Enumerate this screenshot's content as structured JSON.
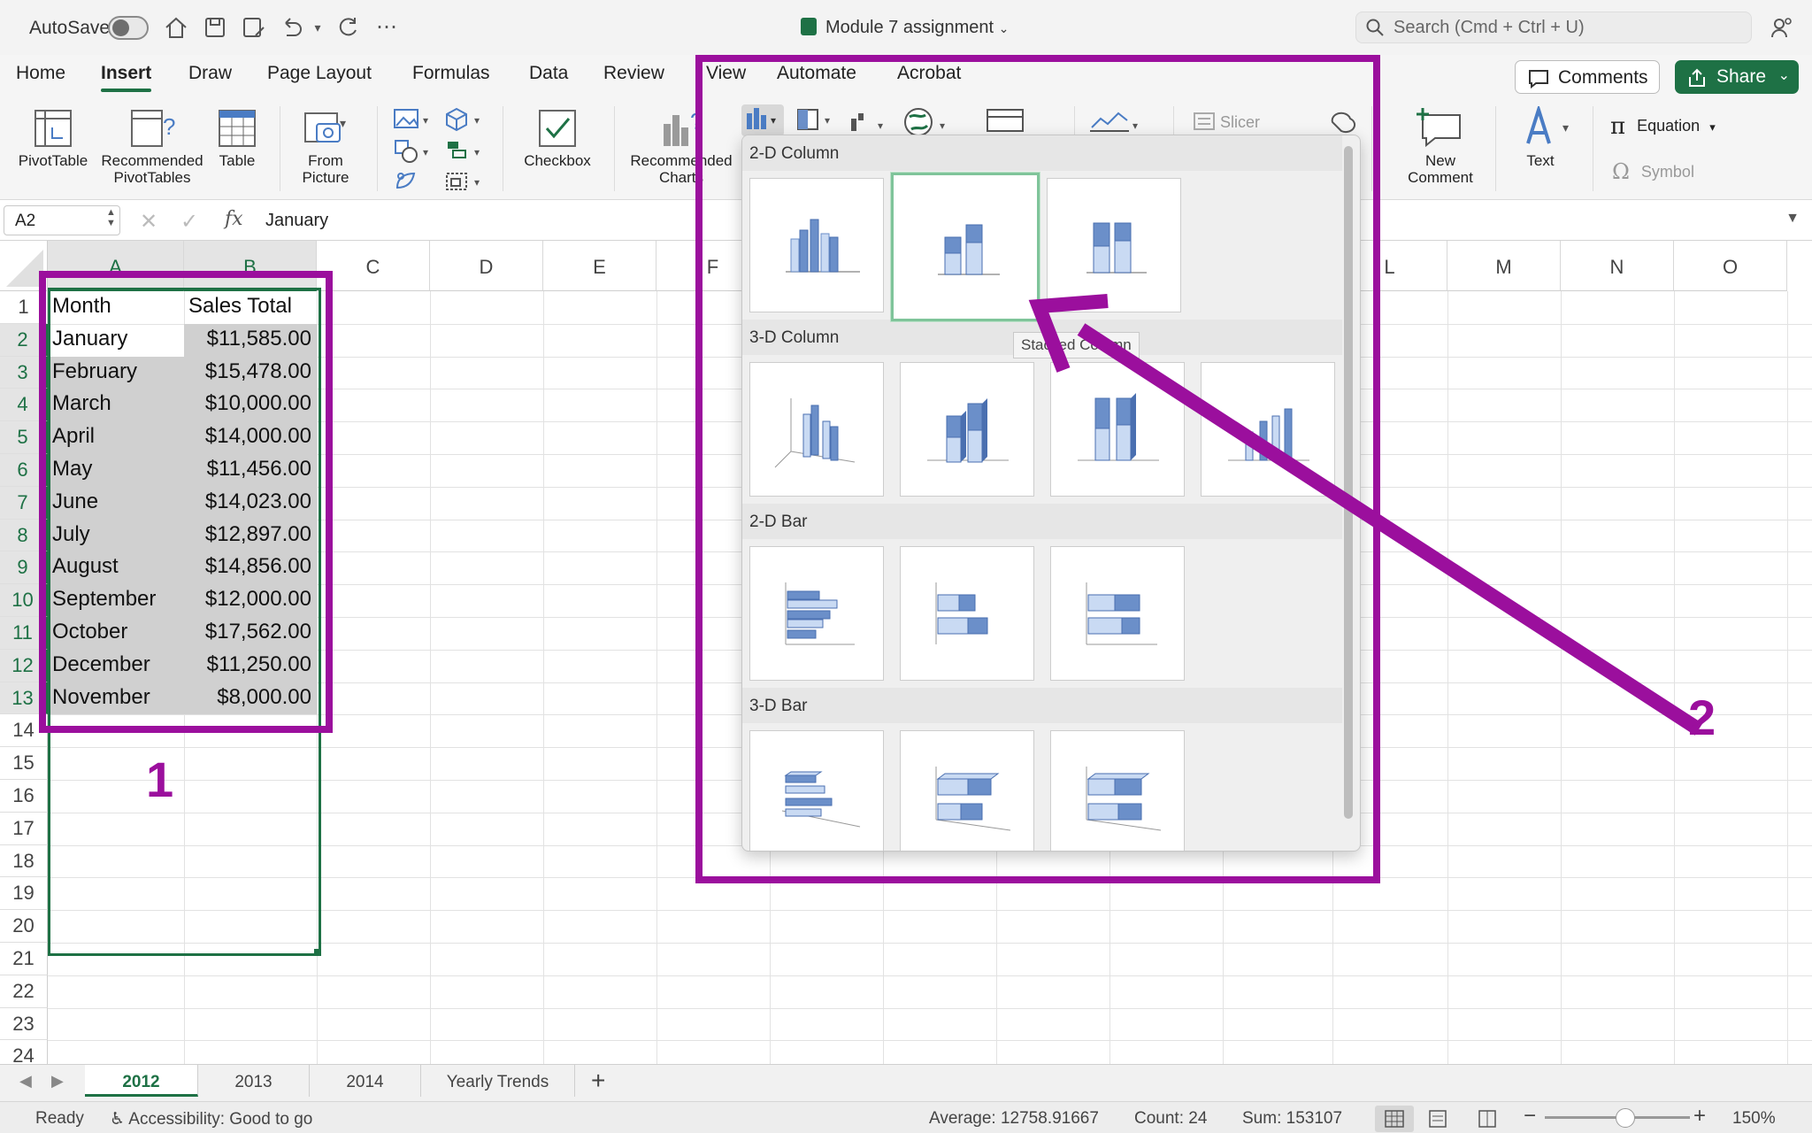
{
  "titlebar": {
    "autosave_label": "AutoSave",
    "document_title": "Module 7 assignment",
    "search_placeholder": "Search (Cmd + Ctrl + U)"
  },
  "ribbon_tabs": [
    "Home",
    "Insert",
    "Draw",
    "Page Layout",
    "Formulas",
    "Data",
    "Review",
    "View",
    "Automate",
    "Acrobat"
  ],
  "active_tab": "Insert",
  "header_buttons": {
    "comments": "Comments",
    "share": "Share"
  },
  "ribbon": {
    "pivot_table": "PivotTable",
    "recommended_pivot_1": "Recommended",
    "recommended_pivot_2": "PivotTables",
    "table": "Table",
    "from_picture_1": "From",
    "from_picture_2": "Picture",
    "checkbox": "Checkbox",
    "recommended_charts_1": "Recommended",
    "recommended_charts_2": "Charts",
    "slicer": "Slicer",
    "new_comment_1": "New",
    "new_comment_2": "Comment",
    "text": "Text",
    "equation": "Equation",
    "symbol": "Symbol"
  },
  "formula_bar": {
    "name_box": "A2",
    "fx": "fx",
    "value": "January"
  },
  "columns": [
    "A",
    "B",
    "C",
    "D",
    "E",
    "F",
    "L",
    "M",
    "N",
    "O"
  ],
  "rows": [
    "1",
    "2",
    "3",
    "4",
    "5",
    "6",
    "7",
    "8",
    "9",
    "10",
    "11",
    "12",
    "13",
    "14",
    "15",
    "16",
    "17",
    "18",
    "19",
    "20",
    "21",
    "22",
    "23",
    "24"
  ],
  "table": {
    "headers": [
      "Month",
      "Sales Total"
    ],
    "data": [
      [
        "January",
        "$11,585.00"
      ],
      [
        "February",
        "$15,478.00"
      ],
      [
        "March",
        "$10,000.00"
      ],
      [
        "April",
        "$14,000.00"
      ],
      [
        "May",
        "$11,456.00"
      ],
      [
        "June",
        "$14,023.00"
      ],
      [
        "July",
        "$12,897.00"
      ],
      [
        "August",
        "$14,856.00"
      ],
      [
        "September",
        "$12,000.00"
      ],
      [
        "October",
        "$17,562.00"
      ],
      [
        "December",
        "$11,250.00"
      ],
      [
        "November",
        "$8,000.00"
      ]
    ]
  },
  "chart_menu": {
    "sections": [
      "2-D Column",
      "3-D Column",
      "2-D Bar",
      "3-D Bar"
    ],
    "tooltip": "Stacked Column",
    "hovered": "2-D Column stacked"
  },
  "annotations": {
    "label_1": "1",
    "label_2": "2",
    "color": "#9b0f9d"
  },
  "sheets": [
    "2012",
    "2013",
    "2014",
    "Yearly Trends"
  ],
  "active_sheet": "2012",
  "status": {
    "ready": "Ready",
    "accessibility": "Accessibility: Good to go",
    "average": "Average: 12758.91667",
    "count": "Count: 24",
    "sum": "Sum: 153107",
    "zoom": "150%"
  },
  "colors": {
    "accent": "#1e7145",
    "annotation": "#9b0f9d",
    "bar_dark": "#6b8fc9",
    "bar_light": "#c9daf3"
  }
}
